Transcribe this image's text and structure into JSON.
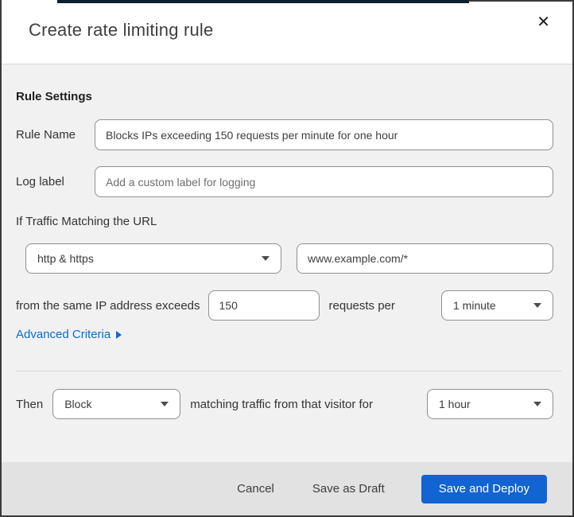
{
  "dialog": {
    "title": "Create rate limiting rule"
  },
  "icons": {
    "close_glyph": "✕",
    "dropdown_caret": "triangle-down",
    "advanced_arrow": "triangle-right"
  },
  "colors": {
    "primary_button_blue": "#1164d2",
    "link_blue": "#0d6cd0",
    "body_background": "#f1f1f1",
    "footer_background": "#e2e2e2",
    "border_dark": "#3a3a3a"
  },
  "rule_settings": {
    "section_title": "Rule Settings",
    "rule_name": {
      "label": "Rule Name",
      "value": "Blocks IPs exceeding 150 requests per minute for one hour"
    },
    "log_label": {
      "label": "Log label",
      "placeholder": "Add a custom label for logging"
    }
  },
  "match": {
    "intro": "If Traffic Matching the URL",
    "scheme_select": {
      "value": "http & https"
    },
    "url_input": {
      "value": "www.example.com/*"
    },
    "threshold_prefix": "from the same IP address exceeds",
    "threshold_value": "150",
    "threshold_suffix": "requests per",
    "period_select": {
      "value": "1 minute"
    },
    "advanced_link_label": "Advanced Criteria"
  },
  "action": {
    "then_label": "Then",
    "action_select": {
      "value": "Block"
    },
    "middle_text": "matching traffic from that visitor for",
    "duration_select": {
      "value": "1 hour"
    }
  },
  "footer": {
    "cancel_label": "Cancel",
    "save_draft_label": "Save as Draft",
    "save_deploy_label": "Save and Deploy"
  }
}
